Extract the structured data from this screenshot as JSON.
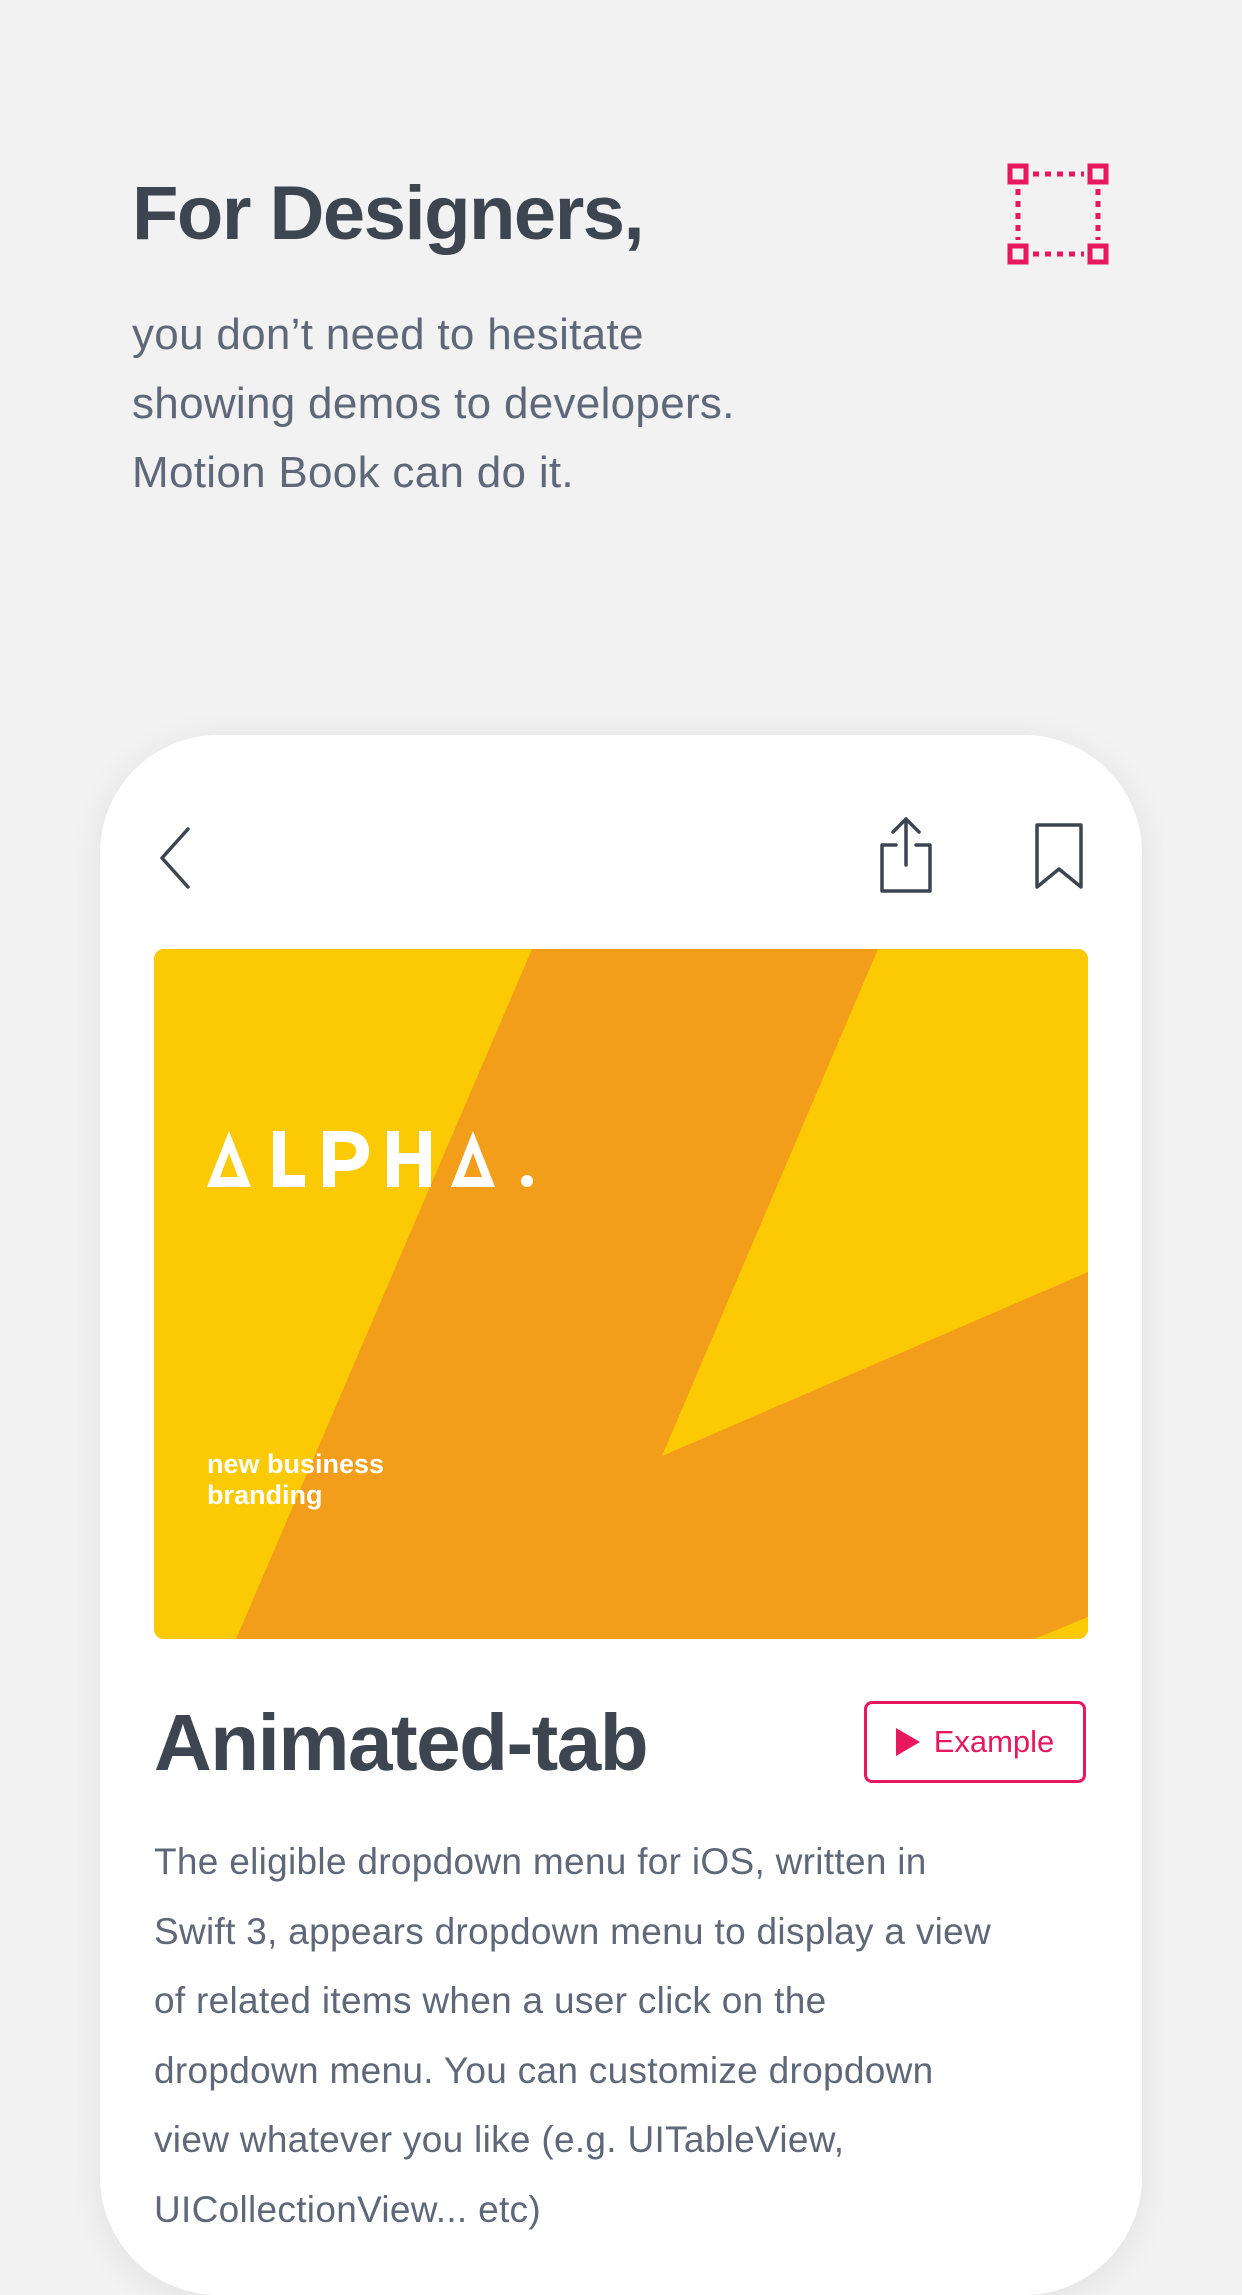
{
  "promo": {
    "title": "For Designers,",
    "lines": [
      "you don’t need to hesitate",
      "showing demos to developers.",
      "Motion Book can do it."
    ],
    "icon": "frame-select-icon"
  },
  "colors": {
    "accent": "#e8185f",
    "background": "#f2f2f3",
    "hero_yellow": "#fbca04",
    "hero_orange": "#f39e1a",
    "title_text": "#3d4550",
    "body_text": "#5f6878"
  },
  "card": {
    "toolbar": {
      "back_icon": "chevron-left-icon",
      "share_icon": "share-icon",
      "bookmark_icon": "bookmark-icon"
    },
    "hero": {
      "logo_text": "ALPHA.",
      "caption_lines": [
        "new business",
        "branding"
      ]
    },
    "title": "Animated-tab",
    "example_button_label": "Example",
    "description_lines": [
      "The eligible dropdown menu for iOS, written in",
      "Swift 3, appears dropdown menu to display a view",
      "of related items when a user click on the",
      "dropdown menu. You can customize dropdown",
      "view whatever you like (e.g. UITableView,",
      "UICollectionView... etc)"
    ]
  }
}
